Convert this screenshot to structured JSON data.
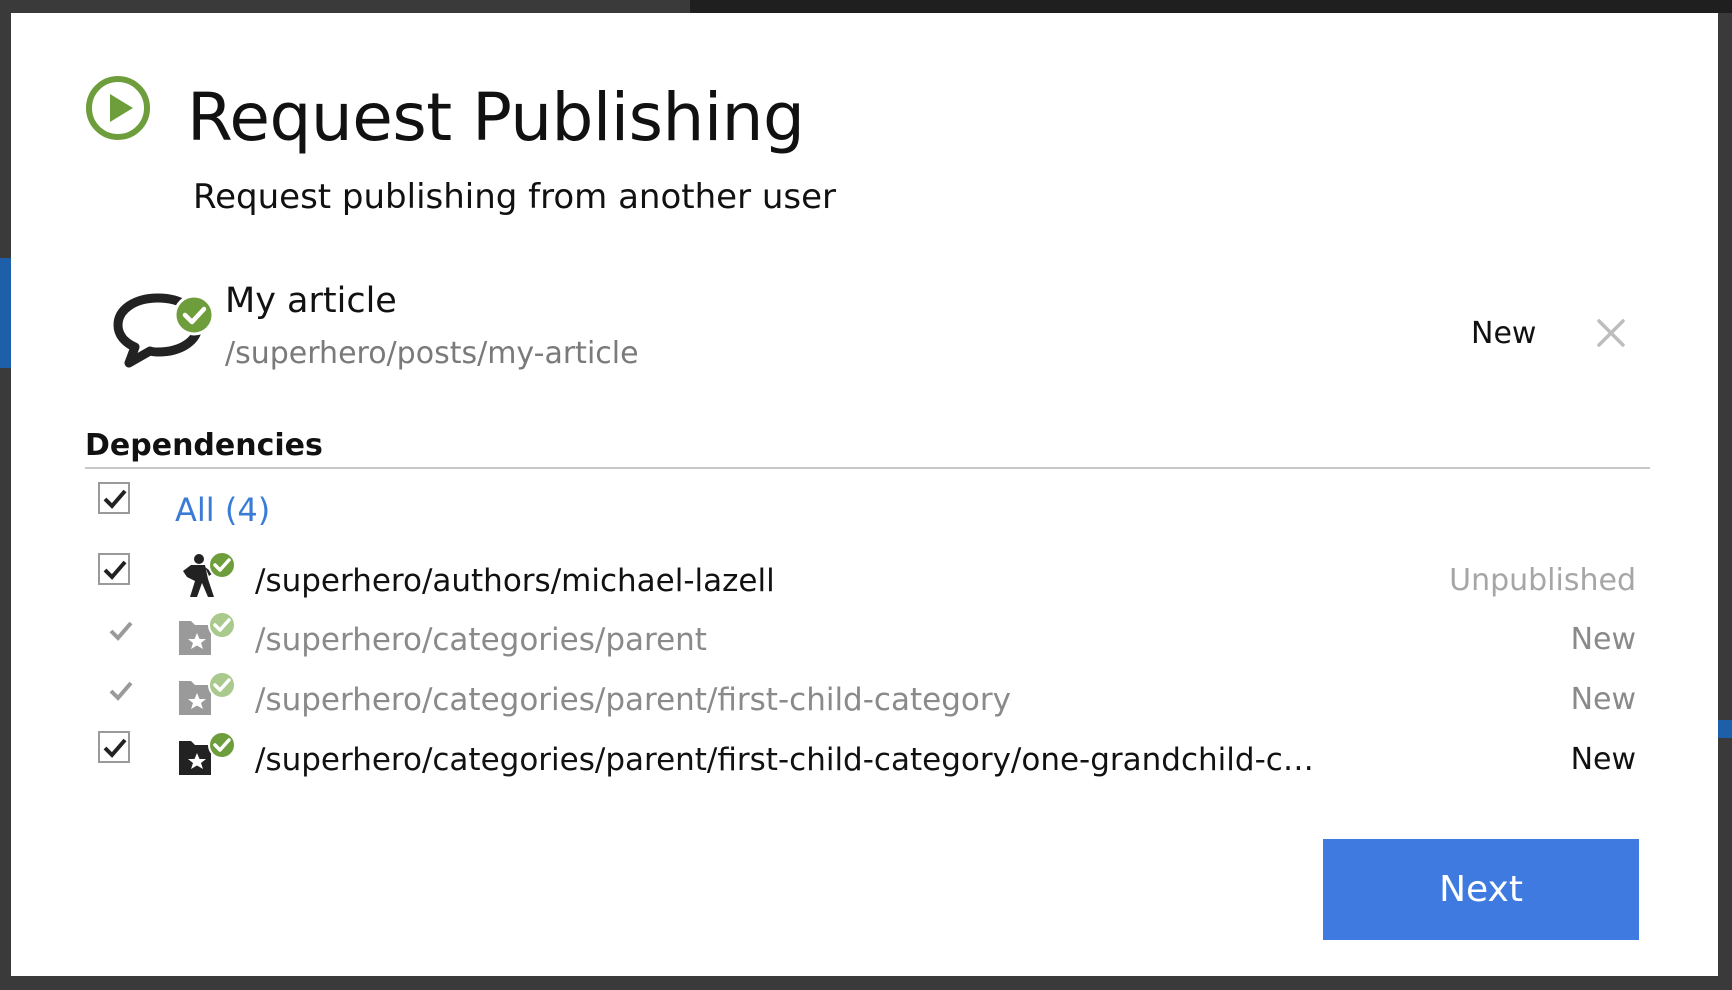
{
  "dialog": {
    "title": "Request Publishing",
    "subtitle": "Request publishing from another user"
  },
  "item": {
    "name": "My article",
    "path": "/superhero/posts/my-article",
    "status": "New",
    "icon": "speech-bubble-icon"
  },
  "dependencies": {
    "heading": "Dependencies",
    "all_label": "All (4)",
    "rows": [
      {
        "path": "/superhero/authors/michael-lazell",
        "status": "Unpublished",
        "icon": "author-icon",
        "checked": true,
        "enabled": true
      },
      {
        "path": "/superhero/categories/parent",
        "status": "New",
        "icon": "category-folder-icon",
        "checked": true,
        "enabled": false
      },
      {
        "path": "/superhero/categories/parent/first-child-category",
        "status": "New",
        "icon": "category-folder-icon",
        "checked": true,
        "enabled": false
      },
      {
        "path": "/superhero/categories/parent/first-child-category/one-grandchild-categor...",
        "status": "New",
        "icon": "category-folder-icon",
        "checked": true,
        "enabled": true
      }
    ]
  },
  "footer": {
    "next_label": "Next"
  },
  "colors": {
    "accent_green": "#6e9e3c",
    "primary_blue": "#3e7ae0",
    "link_blue": "#3a7bd5"
  }
}
